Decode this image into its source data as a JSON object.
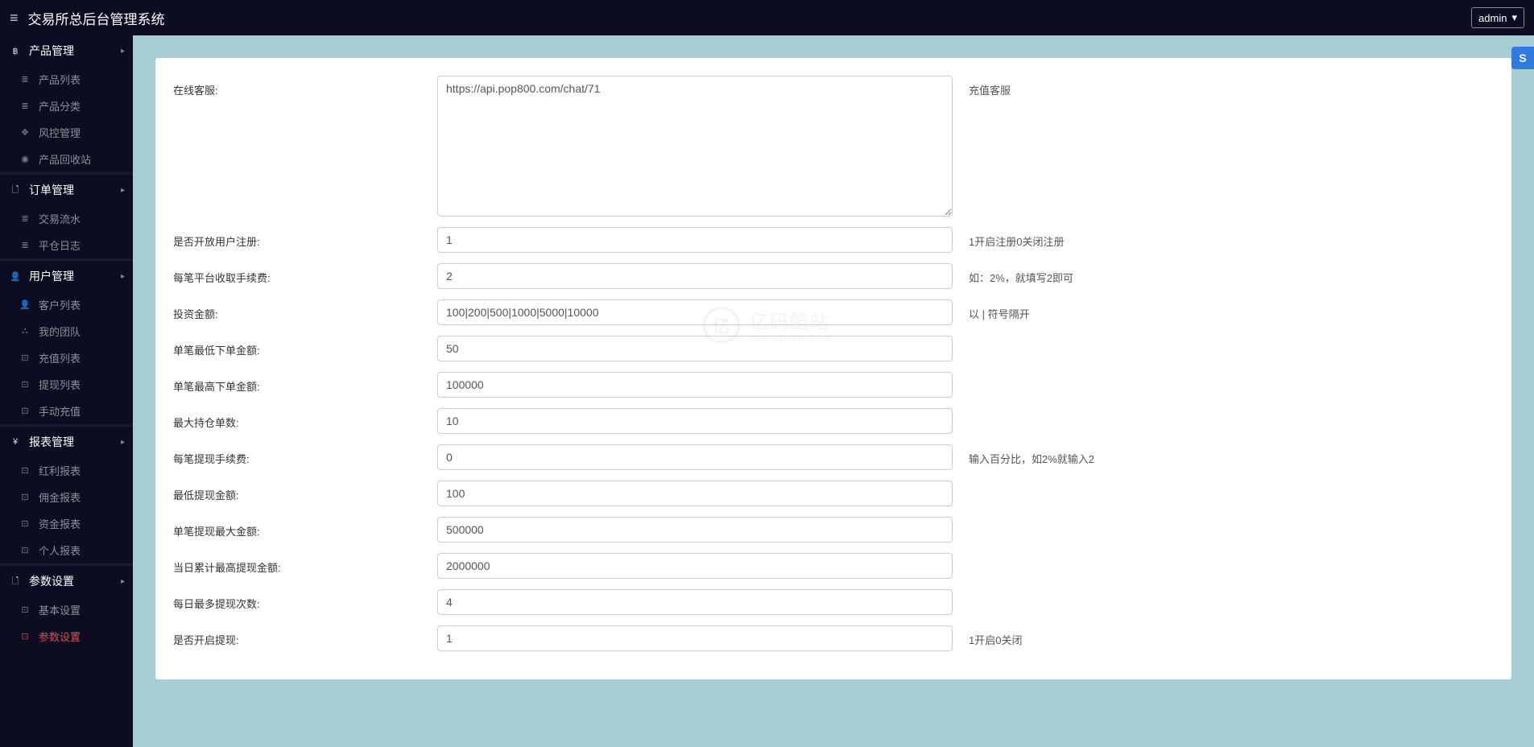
{
  "header": {
    "title": "交易所总后台管理系统",
    "user": "admin"
  },
  "sidebar": {
    "groups": [
      {
        "icon": "฿",
        "label": "产品管理",
        "items": [
          {
            "icon": "≣",
            "label": "产品列表"
          },
          {
            "icon": "≣",
            "label": "产品分类"
          },
          {
            "icon": "✥",
            "label": "风控管理"
          },
          {
            "icon": "◉",
            "label": "产品回收站"
          }
        ]
      },
      {
        "icon": "🗋",
        "label": "订单管理",
        "items": [
          {
            "icon": "≣",
            "label": "交易流水"
          },
          {
            "icon": "≣",
            "label": "平仓日志"
          }
        ]
      },
      {
        "icon": "👤",
        "label": "用户管理",
        "items": [
          {
            "icon": "👤",
            "label": "客户列表"
          },
          {
            "icon": "⛬",
            "label": "我的团队"
          },
          {
            "icon": "⊡",
            "label": "充值列表"
          },
          {
            "icon": "⊡",
            "label": "提现列表"
          },
          {
            "icon": "⊡",
            "label": "手动充值"
          }
        ]
      },
      {
        "icon": "¥",
        "label": "报表管理",
        "items": [
          {
            "icon": "⊡",
            "label": "红利报表"
          },
          {
            "icon": "⊡",
            "label": "佣金报表"
          },
          {
            "icon": "⊡",
            "label": "资金报表"
          },
          {
            "icon": "⊡",
            "label": "个人报表"
          }
        ]
      },
      {
        "icon": "🗋",
        "label": "参数设置",
        "items": [
          {
            "icon": "⊡",
            "label": "基本设置"
          },
          {
            "icon": "⊡",
            "label": "参数设置",
            "active": true
          }
        ]
      }
    ]
  },
  "form": {
    "rows": [
      {
        "label": "在线客服:",
        "value": "https://api.pop800.com/chat/71",
        "type": "textarea",
        "hint": "充值客服"
      },
      {
        "label": "是否开放用户注册:",
        "value": "1",
        "type": "text",
        "hint": "1开启注册0关闭注册"
      },
      {
        "label": "每笔平台收取手续费:",
        "value": "2",
        "type": "text",
        "hint": "如：2%，就填写2即可"
      },
      {
        "label": "投资金额:",
        "value": "100|200|500|1000|5000|10000",
        "type": "text",
        "hint": "以 | 符号隔开"
      },
      {
        "label": "单笔最低下单金额:",
        "value": "50",
        "type": "text",
        "hint": ""
      },
      {
        "label": "单笔最高下单金额:",
        "value": "100000",
        "type": "text",
        "hint": ""
      },
      {
        "label": "最大持仓单数:",
        "value": "10",
        "type": "text",
        "hint": ""
      },
      {
        "label": "每笔提现手续费:",
        "value": "0",
        "type": "text",
        "hint": "输入百分比，如2%就输入2"
      },
      {
        "label": "最低提现金额:",
        "value": "100",
        "type": "text",
        "hint": ""
      },
      {
        "label": "单笔提现最大金额:",
        "value": "500000",
        "type": "text",
        "hint": ""
      },
      {
        "label": "当日累计最高提现金额:",
        "value": "2000000",
        "type": "text",
        "hint": ""
      },
      {
        "label": "每日最多提现次数:",
        "value": "4",
        "type": "text",
        "hint": ""
      },
      {
        "label": "是否开启提现:",
        "value": "1",
        "type": "text",
        "hint": "1开启0关闭"
      }
    ]
  },
  "badge": "S",
  "watermark": {
    "cn": "亿码酷站",
    "en": "YMKUZHAN.COM",
    "circle": "亿"
  }
}
